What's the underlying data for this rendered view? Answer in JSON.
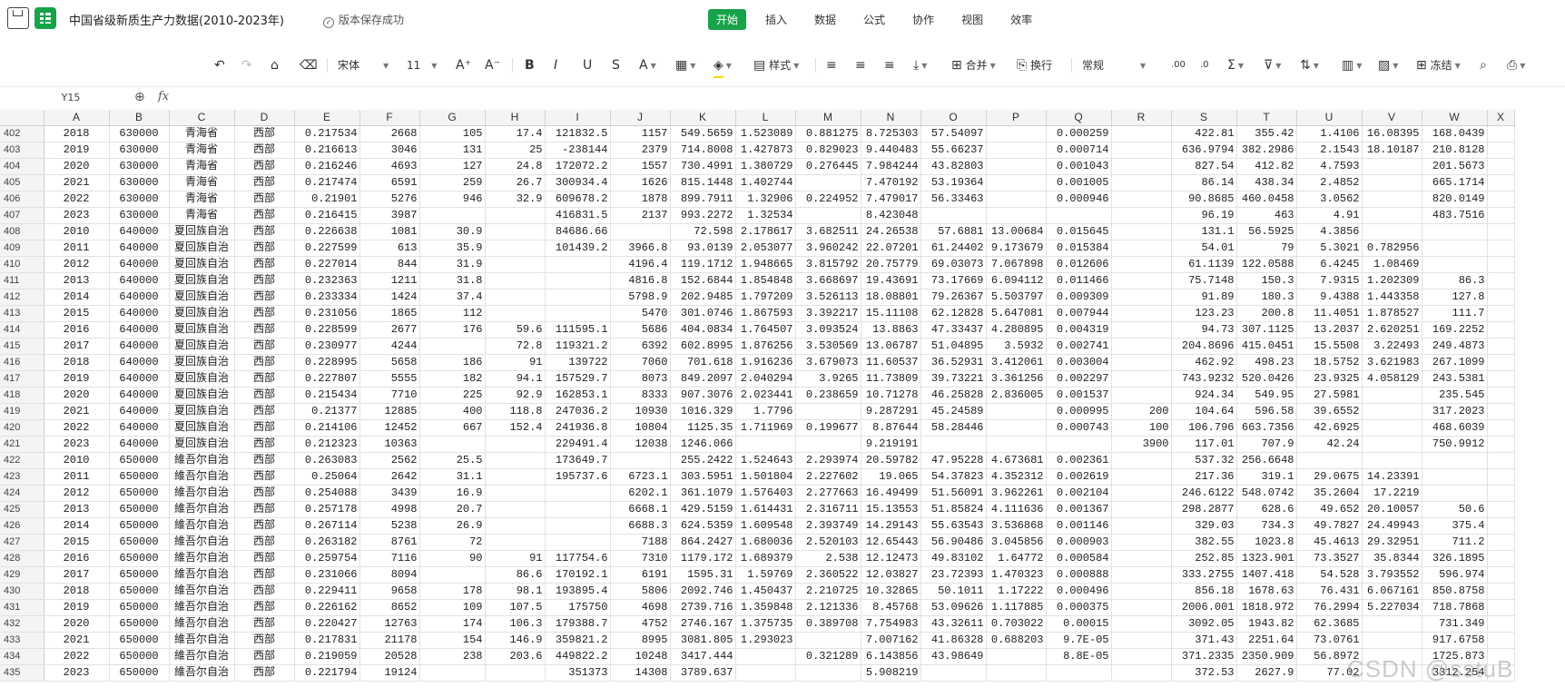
{
  "titlebar": {
    "doc_title": "中国省级新质生产力数据(2010-2023年)",
    "save_status": "版本保存成功",
    "menu_tabs": [
      "开始",
      "插入",
      "数据",
      "公式",
      "协作",
      "视图",
      "效率"
    ]
  },
  "toolbar": {
    "font_name": "宋体",
    "font_size": "11",
    "style_label": "样式",
    "merge_label": "合并",
    "wrap_label": "换行",
    "number_format": "常规",
    "freeze_label": "冻结"
  },
  "formulabar": {
    "cell_ref": "Y15",
    "formula": ""
  },
  "grid": {
    "columns": [
      "A",
      "B",
      "C",
      "D",
      "E",
      "F",
      "G",
      "H",
      "I",
      "J",
      "K",
      "L",
      "M",
      "N",
      "O",
      "P",
      "Q",
      "R",
      "S",
      "T",
      "U",
      "V",
      "W",
      "X"
    ],
    "rows": [
      {
        "n": "402",
        "c": [
          "2018",
          "630000",
          "青海省",
          "西部",
          "0.217534",
          "2668",
          "105",
          "17.4",
          "121832.5",
          "1157",
          "549.5659",
          "1.523089",
          "0.881275",
          "8.725303",
          "57.54097",
          "",
          "0.000259",
          "",
          "422.81",
          "355.42",
          "1.4106",
          "16.08395",
          "168.0439",
          ""
        ]
      },
      {
        "n": "403",
        "c": [
          "2019",
          "630000",
          "青海省",
          "西部",
          "0.216613",
          "3046",
          "131",
          "25",
          "-238144",
          "2379",
          "714.8008",
          "1.427873",
          "0.829023",
          "9.440483",
          "55.66237",
          "",
          "0.000714",
          "",
          "636.9794",
          "382.2986",
          "2.1543",
          "18.10187",
          "210.8128",
          ""
        ]
      },
      {
        "n": "404",
        "c": [
          "2020",
          "630000",
          "青海省",
          "西部",
          "0.216246",
          "4693",
          "127",
          "24.8",
          "172072.2",
          "1557",
          "730.4991",
          "1.380729",
          "0.276445",
          "7.984244",
          "43.82803",
          "",
          "0.001043",
          "",
          "827.54",
          "412.82",
          "4.7593",
          "",
          "201.5673",
          ""
        ]
      },
      {
        "n": "405",
        "c": [
          "2021",
          "630000",
          "青海省",
          "西部",
          "0.217474",
          "6591",
          "259",
          "26.7",
          "300934.4",
          "1626",
          "815.1448",
          "1.402744",
          "",
          "7.470192",
          "53.19364",
          "",
          "0.001005",
          "",
          "86.14",
          "438.34",
          "2.4852",
          "",
          "665.1714",
          ""
        ]
      },
      {
        "n": "406",
        "c": [
          "2022",
          "630000",
          "青海省",
          "西部",
          "0.21901",
          "5276",
          "946",
          "32.9",
          "609678.2",
          "1878",
          "899.7911",
          "1.32906",
          "0.224952",
          "7.479017",
          "56.33463",
          "",
          "0.000946",
          "",
          "90.8685",
          "460.0458",
          "3.0562",
          "",
          "820.0149",
          ""
        ]
      },
      {
        "n": "407",
        "c": [
          "2023",
          "630000",
          "青海省",
          "西部",
          "0.216415",
          "3987",
          "",
          "",
          "416831.5",
          "2137",
          "993.2272",
          "1.32534",
          "",
          "8.423048",
          "",
          "",
          "",
          "",
          "96.19",
          "463",
          "4.91",
          "",
          "483.7516",
          ""
        ]
      },
      {
        "n": "408",
        "c": [
          "2010",
          "640000",
          "夏回族自治",
          "西部",
          "0.226638",
          "1081",
          "30.9",
          "",
          "84686.66",
          "",
          "72.598",
          "2.178617",
          "3.682511",
          "24.26538",
          "57.6881",
          "13.00684",
          "0.015645",
          "",
          "131.1",
          "56.5925",
          "4.3856",
          "",
          "",
          ""
        ]
      },
      {
        "n": "409",
        "c": [
          "2011",
          "640000",
          "夏回族自治",
          "西部",
          "0.227599",
          "613",
          "35.9",
          "",
          "101439.2",
          "3966.8",
          "93.0139",
          "2.053077",
          "3.960242",
          "22.07201",
          "61.24402",
          "9.173679",
          "0.015384",
          "",
          "54.01",
          "79",
          "5.3021",
          "0.782956",
          "",
          ""
        ]
      },
      {
        "n": "410",
        "c": [
          "2012",
          "640000",
          "夏回族自治",
          "西部",
          "0.227014",
          "844",
          "31.9",
          "",
          "",
          "4196.4",
          "119.1712",
          "1.948665",
          "3.815792",
          "20.75779",
          "69.03073",
          "7.067898",
          "0.012606",
          "",
          "61.1139",
          "122.0588",
          "6.4245",
          "1.08469",
          "",
          ""
        ]
      },
      {
        "n": "411",
        "c": [
          "2013",
          "640000",
          "夏回族自治",
          "西部",
          "0.232363",
          "1211",
          "31.8",
          "",
          "",
          "4816.8",
          "152.6844",
          "1.854848",
          "3.668697",
          "19.43691",
          "73.17669",
          "6.094112",
          "0.011466",
          "",
          "75.7148",
          "150.3",
          "7.9315",
          "1.202309",
          "86.3",
          ""
        ]
      },
      {
        "n": "412",
        "c": [
          "2014",
          "640000",
          "夏回族自治",
          "西部",
          "0.233334",
          "1424",
          "37.4",
          "",
          "",
          "5798.9",
          "202.9485",
          "1.797209",
          "3.526113",
          "18.08801",
          "79.26367",
          "5.503797",
          "0.009309",
          "",
          "91.89",
          "180.3",
          "9.4388",
          "1.443358",
          "127.8",
          ""
        ]
      },
      {
        "n": "413",
        "c": [
          "2015",
          "640000",
          "夏回族自治",
          "西部",
          "0.231056",
          "1865",
          "112",
          "",
          "",
          "5470",
          "301.0746",
          "1.867593",
          "3.392217",
          "15.11108",
          "62.12828",
          "5.647081",
          "0.007944",
          "",
          "123.23",
          "200.8",
          "11.4051",
          "1.878527",
          "111.7",
          ""
        ]
      },
      {
        "n": "414",
        "c": [
          "2016",
          "640000",
          "夏回族自治",
          "西部",
          "0.228599",
          "2677",
          "176",
          "59.6",
          "111595.1",
          "5686",
          "404.0834",
          "1.764507",
          "3.093524",
          "13.8863",
          "47.33437",
          "4.280895",
          "0.004319",
          "",
          "94.73",
          "307.1125",
          "13.2037",
          "2.620251",
          "169.2252",
          ""
        ]
      },
      {
        "n": "415",
        "c": [
          "2017",
          "640000",
          "夏回族自治",
          "西部",
          "0.230977",
          "4244",
          "",
          "72.8",
          "119321.2",
          "6392",
          "602.8995",
          "1.876256",
          "3.530569",
          "13.06787",
          "51.04895",
          "3.5932",
          "0.002741",
          "",
          "204.8696",
          "415.0451",
          "15.5508",
          "3.22493",
          "249.4873",
          ""
        ]
      },
      {
        "n": "416",
        "c": [
          "2018",
          "640000",
          "夏回族自治",
          "西部",
          "0.228995",
          "5658",
          "186",
          "91",
          "139722",
          "7060",
          "701.618",
          "1.916236",
          "3.679073",
          "11.60537",
          "36.52931",
          "3.412061",
          "0.003004",
          "",
          "462.92",
          "498.23",
          "18.5752",
          "3.621983",
          "267.1099",
          ""
        ]
      },
      {
        "n": "417",
        "c": [
          "2019",
          "640000",
          "夏回族自治",
          "西部",
          "0.227807",
          "5555",
          "182",
          "94.1",
          "157529.7",
          "8073",
          "849.2097",
          "2.040294",
          "3.9265",
          "11.73809",
          "39.73221",
          "3.361256",
          "0.002297",
          "",
          "743.9232",
          "520.0426",
          "23.9325",
          "4.058129",
          "243.5381",
          ""
        ]
      },
      {
        "n": "418",
        "c": [
          "2020",
          "640000",
          "夏回族自治",
          "西部",
          "0.215434",
          "7710",
          "225",
          "92.9",
          "162853.1",
          "8333",
          "907.3076",
          "2.023441",
          "0.238659",
          "10.71278",
          "46.25828",
          "2.836005",
          "0.001537",
          "",
          "924.34",
          "549.95",
          "27.5981",
          "",
          "235.545",
          ""
        ]
      },
      {
        "n": "419",
        "c": [
          "2021",
          "640000",
          "夏回族自治",
          "西部",
          "0.21377",
          "12885",
          "400",
          "118.8",
          "247036.2",
          "10930",
          "1016.329",
          "1.7796",
          "",
          "9.287291",
          "45.24589",
          "",
          "0.000995",
          "200",
          "104.64",
          "596.58",
          "39.6552",
          "",
          "317.2023",
          ""
        ]
      },
      {
        "n": "420",
        "c": [
          "2022",
          "640000",
          "夏回族自治",
          "西部",
          "0.214106",
          "12452",
          "667",
          "152.4",
          "241936.8",
          "10804",
          "1125.35",
          "1.711969",
          "0.199677",
          "8.87644",
          "58.28446",
          "",
          "0.000743",
          "100",
          "106.796",
          "663.7356",
          "42.6925",
          "",
          "468.6039",
          ""
        ]
      },
      {
        "n": "421",
        "c": [
          "2023",
          "640000",
          "夏回族自治",
          "西部",
          "0.212323",
          "10363",
          "",
          "",
          "229491.4",
          "12038",
          "1246.066",
          "",
          "",
          "9.219191",
          "",
          "",
          "",
          "3900",
          "117.01",
          "707.9",
          "42.24",
          "",
          "750.9912",
          ""
        ]
      },
      {
        "n": "422",
        "c": [
          "2010",
          "650000",
          "維吾尔自治",
          "西部",
          "0.263083",
          "2562",
          "25.5",
          "",
          "173649.7",
          "",
          "255.2422",
          "1.524643",
          "2.293974",
          "20.59782",
          "47.95228",
          "4.673681",
          "0.002361",
          "",
          "537.32",
          "256.6648",
          "",
          "",
          "",
          ""
        ]
      },
      {
        "n": "423",
        "c": [
          "2011",
          "650000",
          "維吾尔自治",
          "西部",
          "0.25064",
          "2642",
          "31.1",
          "",
          "195737.6",
          "6723.1",
          "303.5951",
          "1.501804",
          "2.227602",
          "19.065",
          "54.37823",
          "4.352312",
          "0.002619",
          "",
          "217.36",
          "319.1",
          "29.0675",
          "14.23391",
          "",
          ""
        ]
      },
      {
        "n": "424",
        "c": [
          "2012",
          "650000",
          "維吾尔自治",
          "西部",
          "0.254088",
          "3439",
          "16.9",
          "",
          "",
          "6202.1",
          "361.1079",
          "1.576403",
          "2.277663",
          "16.49499",
          "51.56091",
          "3.962261",
          "0.002104",
          "",
          "246.6122",
          "548.0742",
          "35.2604",
          "17.2219",
          "",
          ""
        ]
      },
      {
        "n": "425",
        "c": [
          "2013",
          "650000",
          "維吾尔自治",
          "西部",
          "0.257178",
          "4998",
          "20.7",
          "",
          "",
          "6668.1",
          "429.5159",
          "1.614431",
          "2.316711",
          "15.13553",
          "51.85824",
          "4.111636",
          "0.001367",
          "",
          "298.2877",
          "628.6",
          "49.652",
          "20.10057",
          "50.6",
          ""
        ]
      },
      {
        "n": "426",
        "c": [
          "2014",
          "650000",
          "維吾尔自治",
          "西部",
          "0.267114",
          "5238",
          "26.9",
          "",
          "",
          "6688.3",
          "624.5359",
          "1.609548",
          "2.393749",
          "14.29143",
          "55.63543",
          "3.536868",
          "0.001146",
          "",
          "329.03",
          "734.3",
          "49.7827",
          "24.49943",
          "375.4",
          ""
        ]
      },
      {
        "n": "427",
        "c": [
          "2015",
          "650000",
          "維吾尔自治",
          "西部",
          "0.263182",
          "8761",
          "72",
          "",
          "",
          "7188",
          "864.2427",
          "1.680036",
          "2.520103",
          "12.65443",
          "56.90486",
          "3.045856",
          "0.000903",
          "",
          "382.55",
          "1023.8",
          "45.4613",
          "29.32951",
          "711.2",
          ""
        ]
      },
      {
        "n": "428",
        "c": [
          "2016",
          "650000",
          "維吾尔自治",
          "西部",
          "0.259754",
          "7116",
          "90",
          "91",
          "117754.6",
          "7310",
          "1179.172",
          "1.689379",
          "2.538",
          "12.12473",
          "49.83102",
          "1.64772",
          "0.000584",
          "",
          "252.85",
          "1323.901",
          "73.3527",
          "35.8344",
          "326.1895",
          ""
        ]
      },
      {
        "n": "429",
        "c": [
          "2017",
          "650000",
          "維吾尔自治",
          "西部",
          "0.231066",
          "8094",
          "",
          "86.6",
          "170192.1",
          "6191",
          "1595.31",
          "1.59769",
          "2.360522",
          "12.03827",
          "23.72393",
          "1.470323",
          "0.000888",
          "",
          "333.2755",
          "1407.418",
          "54.528",
          "3.793552",
          "596.974",
          ""
        ]
      },
      {
        "n": "430",
        "c": [
          "2018",
          "650000",
          "維吾尔自治",
          "西部",
          "0.229411",
          "9658",
          "178",
          "98.1",
          "193895.4",
          "5806",
          "2092.746",
          "1.450437",
          "2.210725",
          "10.32865",
          "50.1011",
          "1.17222",
          "0.000496",
          "",
          "856.18",
          "1678.63",
          "76.431",
          "6.067161",
          "850.8758",
          ""
        ]
      },
      {
        "n": "431",
        "c": [
          "2019",
          "650000",
          "維吾尔自治",
          "西部",
          "0.226162",
          "8652",
          "109",
          "107.5",
          "175750",
          "4698",
          "2739.716",
          "1.359848",
          "2.121336",
          "8.45768",
          "53.09626",
          "1.117885",
          "0.000375",
          "",
          "2006.001",
          "1818.972",
          "76.2994",
          "5.227034",
          "718.7868",
          ""
        ]
      },
      {
        "n": "432",
        "c": [
          "2020",
          "650000",
          "維吾尔自治",
          "西部",
          "0.220427",
          "12763",
          "174",
          "106.3",
          "179388.7",
          "4752",
          "2746.167",
          "1.375735",
          "0.389708",
          "7.754983",
          "43.32611",
          "0.703022",
          "0.00015",
          "",
          "3092.05",
          "1943.82",
          "62.3685",
          "",
          "731.349",
          ""
        ]
      },
      {
        "n": "433",
        "c": [
          "2021",
          "650000",
          "維吾尔自治",
          "西部",
          "0.217831",
          "21178",
          "154",
          "146.9",
          "359821.2",
          "8995",
          "3081.805",
          "1.293023",
          "",
          "7.007162",
          "41.86328",
          "0.688203",
          "9.7E-05",
          "",
          "371.43",
          "2251.64",
          "73.0761",
          "",
          "917.6758",
          ""
        ]
      },
      {
        "n": "434",
        "c": [
          "2022",
          "650000",
          "維吾尔自治",
          "西部",
          "0.219059",
          "20528",
          "238",
          "203.6",
          "449822.2",
          "10248",
          "3417.444",
          "",
          "0.321289",
          "6.143856",
          "43.98649",
          "",
          "8.8E-05",
          "",
          "371.2335",
          "2350.909",
          "56.8972",
          "",
          "1725.873",
          ""
        ]
      },
      {
        "n": "435",
        "c": [
          "2023",
          "650000",
          "維吾尔自治",
          "西部",
          "0.221794",
          "19124",
          "",
          "",
          "351373",
          "14308",
          "3789.637",
          "",
          "",
          "5.908219",
          "",
          "",
          "",
          "",
          "372.53",
          "2627.9",
          "77.02",
          "",
          "3312.254",
          ""
        ]
      }
    ]
  },
  "watermark": "CSDN @sstuB"
}
